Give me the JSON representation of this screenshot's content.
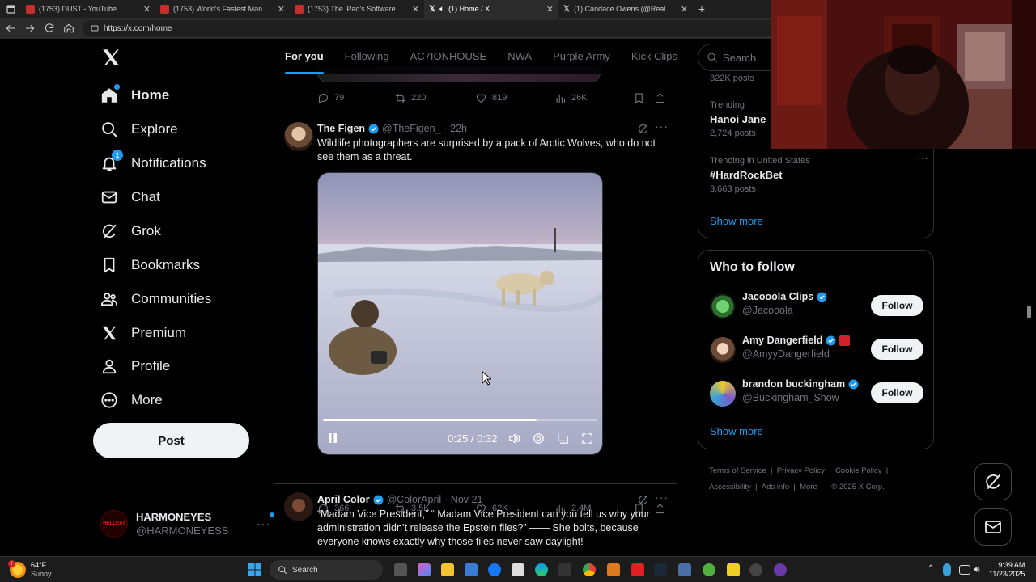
{
  "browser": {
    "tabs": [
      {
        "title": "(1753) DUST - YouTube",
        "icon": "youtube-icon"
      },
      {
        "title": "(1753) World's Fastest Man Vs Ro",
        "icon": "youtube-icon"
      },
      {
        "title": "(1753) The iPad's Software Proble",
        "icon": "youtube-icon"
      },
      {
        "title": "(1) Home / X",
        "icon": "x-icon",
        "active": true
      },
      {
        "title": "(1) Candace Owens (@RealCand",
        "icon": "x-icon"
      }
    ],
    "url": "https://x.com/home"
  },
  "nav": {
    "items": [
      {
        "label": "Home",
        "icon": "home-icon",
        "active": true
      },
      {
        "label": "Explore",
        "icon": "search-icon"
      },
      {
        "label": "Notifications",
        "icon": "bell-icon",
        "badge": "1"
      },
      {
        "label": "Chat",
        "icon": "mail-icon"
      },
      {
        "label": "Grok",
        "icon": "grok-icon"
      },
      {
        "label": "Bookmarks",
        "icon": "bookmark-icon"
      },
      {
        "label": "Communities",
        "icon": "communities-icon"
      },
      {
        "label": "Premium",
        "icon": "x-icon"
      },
      {
        "label": "Profile",
        "icon": "person-icon"
      },
      {
        "label": "More",
        "icon": "more-circle-icon"
      }
    ],
    "post_label": "Post",
    "account": {
      "name": "HARMONEYES",
      "handle": "@HARMONEYESS",
      "avatar_text": "HELLCAT"
    }
  },
  "feed": {
    "tabs": [
      "For you",
      "Following",
      "AC7IONHOUSE",
      "NWA",
      "Purple Army",
      "Kick Clips"
    ],
    "top_actions": {
      "replies": "79",
      "reposts": "220",
      "likes": "819",
      "views": "26K"
    },
    "posts": [
      {
        "name": "The Figen",
        "handle": "@TheFigen_",
        "time": "· 22h",
        "text": "Wildlife photographers are surprised by a pack of Arctic Wolves, who do not see them as a threat.",
        "video": {
          "time": "0:25 / 0:32",
          "progress": 0.78
        },
        "actions": {
          "replies": "366",
          "reposts": "3.5K",
          "likes": "62K",
          "views": "2.4M"
        }
      },
      {
        "name": "April Color",
        "handle": "@ColorApril",
        "time": "· Nov 21",
        "text": "“Madam Vice President,” “ Madam Vice President can you tell us why your administration didn’t release the Epstein files?” —— She bolts, because everyone knows exactly why those files never saw daylight!"
      }
    ]
  },
  "sidebar": {
    "search_placeholder": "Search",
    "trends": [
      {
        "top": "",
        "title": "",
        "count": "322K posts"
      },
      {
        "top": "Trending",
        "title": "Hanoi Jane",
        "count": "2,724 posts"
      },
      {
        "top": "Trending in United States",
        "title": "#HardRockBet",
        "count": "3,663 posts"
      }
    ],
    "trends_show_more": "Show more",
    "who_title": "Who to follow",
    "who": [
      {
        "name": "Jacooola Clips",
        "handle": "@Jacooola",
        "button": "Follow"
      },
      {
        "name": "Amy Dangerfield",
        "handle": "@AmyyDangerfield",
        "button": "Follow"
      },
      {
        "name": "brandon buckingham",
        "handle": "@Buckingham_Show",
        "button": "Follow"
      }
    ],
    "who_show_more": "Show more",
    "footer": [
      "Terms of Service",
      "|",
      "Privacy Policy",
      "|",
      "Cookie Policy",
      "|",
      "Accessibility",
      "|",
      "Ads info",
      "|",
      "More ···",
      "© 2025 X Corp."
    ]
  },
  "taskbar": {
    "weather_temp": "64°F",
    "weather_desc": "Sunny",
    "search_label": "Search",
    "time": "9:39 AM",
    "date": "11/23/2025"
  },
  "colors": {
    "accent": "#1d9bf0",
    "background": "#000000",
    "border": "#2f3336",
    "muted": "#71767b"
  }
}
